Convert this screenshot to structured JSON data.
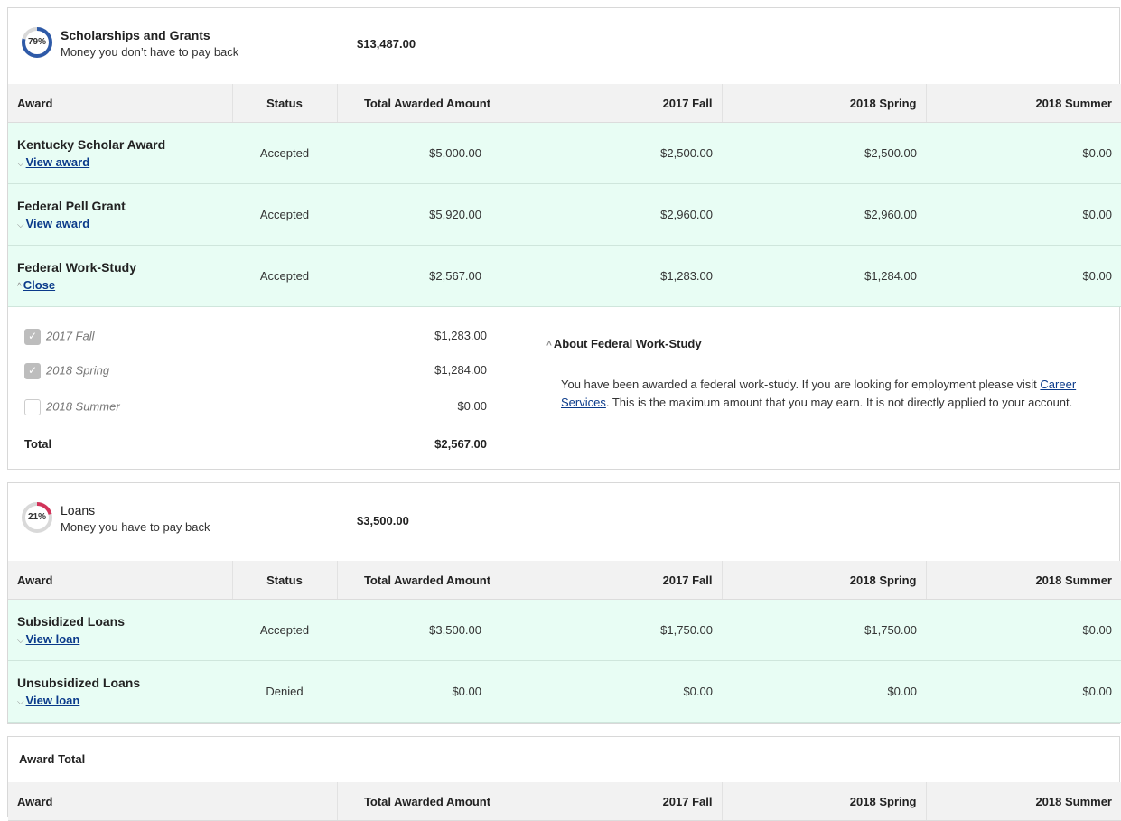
{
  "colors": {
    "grant_ring": "#2e5aa8",
    "loan_ring": "#d2335a",
    "row_bg": "#e8fdf4",
    "link": "#0a3a8a"
  },
  "scholarships": {
    "percent": "79%",
    "percent_value": 0.79,
    "title": "Scholarships and Grants",
    "subtitle": "Money you don’t have to pay back",
    "amount": "$13,487.00",
    "columns": [
      "Award",
      "Status",
      "Total Awarded Amount",
      "2017 Fall",
      "2018 Spring",
      "2018 Summer"
    ],
    "rows": [
      {
        "name": "Kentucky Scholar Award",
        "toggle": "View award",
        "status": "Accepted",
        "total": "$5,000.00",
        "fall": "$2,500.00",
        "spring": "$2,500.00",
        "summer": "$0.00"
      },
      {
        "name": "Federal Pell Grant",
        "toggle": "View award",
        "status": "Accepted",
        "total": "$5,920.00",
        "fall": "$2,960.00",
        "spring": "$2,960.00",
        "summer": "$0.00"
      },
      {
        "name": "Federal Work-Study",
        "toggle": "Close",
        "status": "Accepted",
        "total": "$2,567.00",
        "fall": "$1,283.00",
        "spring": "$1,284.00",
        "summer": "$0.00"
      }
    ],
    "detail": {
      "terms": [
        {
          "label": "2017 Fall",
          "amount": "$1,283.00",
          "checked": true
        },
        {
          "label": "2018 Spring",
          "amount": "$1,284.00",
          "checked": true
        },
        {
          "label": "2018 Summer",
          "amount": "$0.00",
          "checked": false
        }
      ],
      "total_label": "Total",
      "total": "$2,567.00",
      "about_title": "About Federal Work-Study",
      "about_pre": "You have been awarded a federal work-study. If you are looking for employment please visit ",
      "about_link": "Career Services",
      "about_post": ". This is the maximum amount that you may earn. It is not directly applied to your account."
    }
  },
  "loans": {
    "percent": "21%",
    "percent_value": 0.21,
    "title": "Loans",
    "subtitle": "Money you have to pay back",
    "amount": "$3,500.00",
    "columns": [
      "Award",
      "Status",
      "Total Awarded Amount",
      "2017 Fall",
      "2018 Spring",
      "2018 Summer"
    ],
    "rows": [
      {
        "name": "Subsidized Loans",
        "toggle": "View loan",
        "status": "Accepted",
        "total": "$3,500.00",
        "fall": "$1,750.00",
        "spring": "$1,750.00",
        "summer": "$0.00"
      },
      {
        "name": "Unsubsidized Loans",
        "toggle": "View loan",
        "status": "Denied",
        "total": "$0.00",
        "fall": "$0.00",
        "spring": "$0.00",
        "summer": "$0.00"
      }
    ]
  },
  "award_total": {
    "title": "Award Total",
    "columns": [
      "Award",
      "Total Awarded Amount",
      "2017 Fall",
      "2018 Spring",
      "2018 Summer"
    ]
  }
}
